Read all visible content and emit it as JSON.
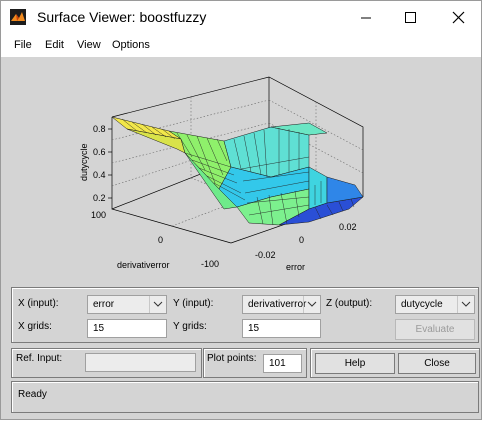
{
  "window": {
    "title": "Surface Viewer: boostfuzzy",
    "icon": "matlab-icon",
    "controls": [
      "minimize-icon",
      "maximize-icon",
      "close-icon"
    ]
  },
  "menu": [
    "File",
    "Edit",
    "View",
    "Options"
  ],
  "plot": {
    "zlabel": "dutycycle",
    "xlabel": "error",
    "ylabel": "derivativerror",
    "zticks": [
      "0.8",
      "0.6",
      "0.4",
      "0.2"
    ],
    "xticks": [
      "-0.02",
      "0",
      "0.02"
    ],
    "yticks": [
      "100",
      "0",
      "-100"
    ],
    "colors": {
      "high": "#f2e74a",
      "mid": "#74f09a",
      "cyan": "#33c8ea",
      "low": "#2a4fd6"
    }
  },
  "controls": {
    "x_input_label": "X (input):",
    "x_input_value": "error",
    "y_input_label": "Y (input):",
    "y_input_value": "derivativerror",
    "z_output_label": "Z (output):",
    "z_output_value": "dutycycle",
    "x_grids_label": "X grids:",
    "x_grids_value": "15",
    "y_grids_label": "Y grids:",
    "y_grids_value": "15",
    "evaluate_label": "Evaluate",
    "ref_input_label": "Ref. Input:",
    "ref_input_value": "",
    "plot_points_label": "Plot points:",
    "plot_points_value": "101",
    "help_label": "Help",
    "close_label": "Close"
  },
  "status": {
    "text": "Ready"
  }
}
